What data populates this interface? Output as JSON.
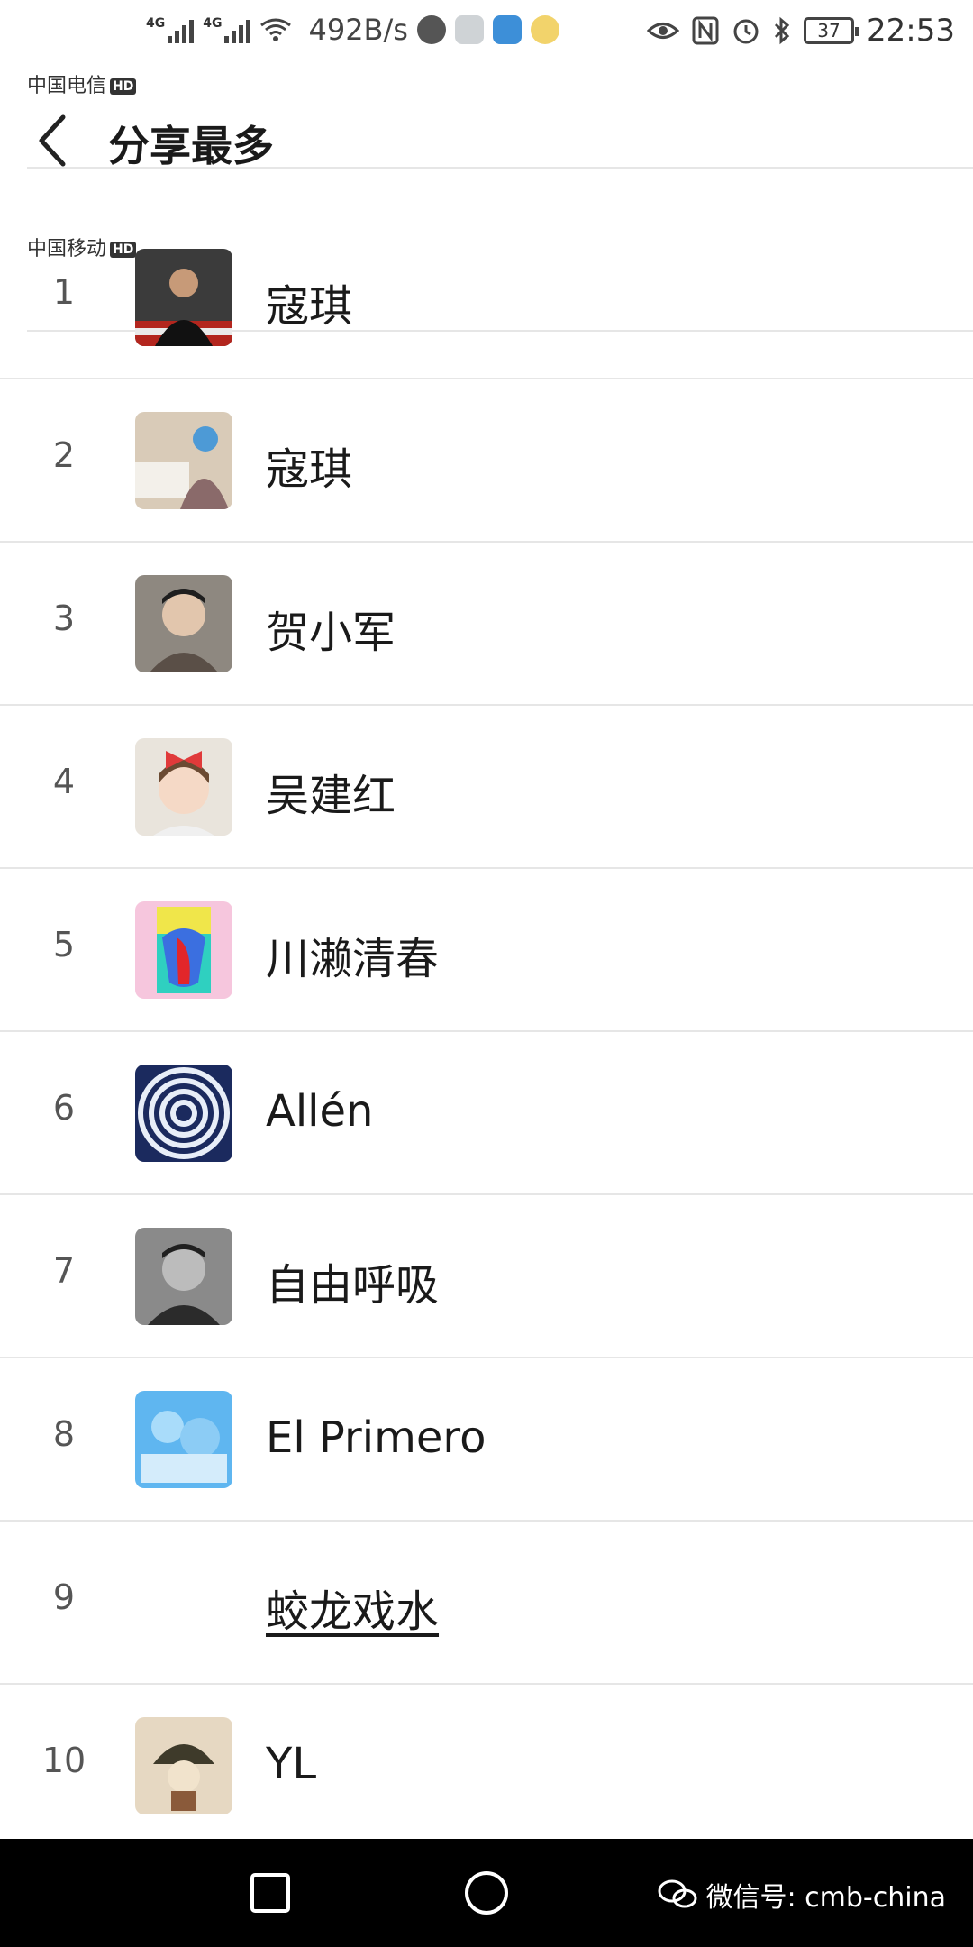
{
  "status_bar": {
    "carrier1": "中国电信",
    "carrier2": "中国移动",
    "hd": "HD",
    "network_tag": "4G",
    "speed": "492B/s",
    "battery": "37",
    "time": "22:53"
  },
  "header": {
    "title": "分享最多"
  },
  "rankings": [
    {
      "rank": "1",
      "name": "寇琪"
    },
    {
      "rank": "2",
      "name": "寇琪"
    },
    {
      "rank": "3",
      "name": "贺小军"
    },
    {
      "rank": "4",
      "name": "吴建红"
    },
    {
      "rank": "5",
      "name": "川濑清春"
    },
    {
      "rank": "6",
      "name": "Allén"
    },
    {
      "rank": "7",
      "name": "自由呼吸"
    },
    {
      "rank": "8",
      "name": "El Primero"
    },
    {
      "rank": "9",
      "name": "蛟龙戏水"
    },
    {
      "rank": "10",
      "name": "YL"
    }
  ],
  "watermark": "微信号: cmb-china",
  "colors": {
    "background": "#ffffff",
    "divider": "#e6e6e6",
    "navbar": "#000000"
  }
}
